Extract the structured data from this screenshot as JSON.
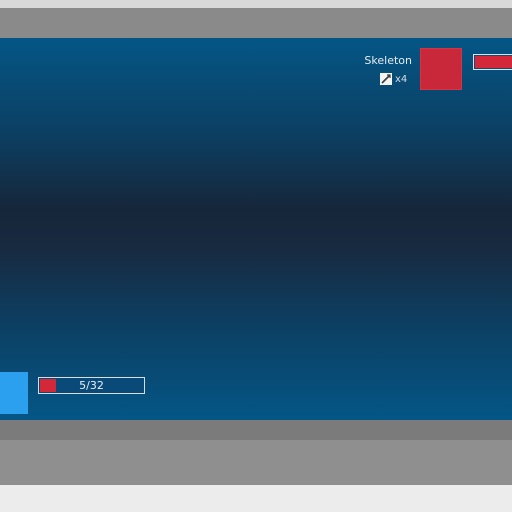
{
  "colors": {
    "battle_bg_top": "#045686",
    "battle_bg_mid": "#16263a",
    "enemy_color": "#c8283a",
    "player_color": "#2ba0ee",
    "hp_fill": "#d2283a"
  },
  "enemy": {
    "name": "Skeleton",
    "count_icon": "sword-icon",
    "count": "x4",
    "hp_fraction": 0.9
  },
  "player": {
    "hp_text": "5/32",
    "hp_current": 5,
    "hp_max": 32
  }
}
